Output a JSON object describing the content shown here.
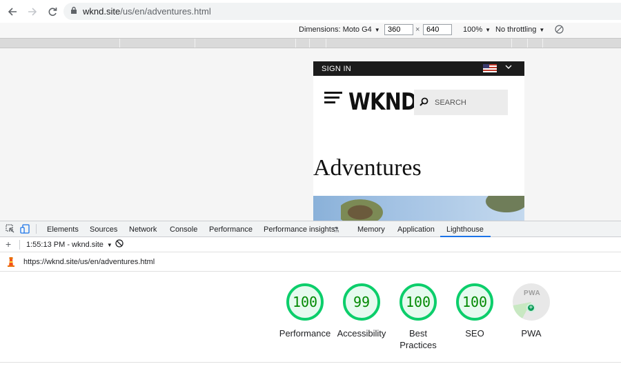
{
  "browser": {
    "url_host": "wknd.site",
    "url_path": "/us/en/adventures.html",
    "icons": [
      "back-arrow-icon",
      "forward-arrow-icon",
      "reload-icon",
      "lock-icon"
    ]
  },
  "device_toolbar": {
    "dimensions_label": "Dimensions: Moto G4",
    "width": "360",
    "height": "640",
    "times": "×",
    "zoom": "100%",
    "throttling": "No throttling"
  },
  "site": {
    "sign_in": "SIGN IN",
    "logo": "WKND",
    "search_placeholder": "SEARCH",
    "page_title": "Adventures"
  },
  "devtools": {
    "tabs": [
      "Elements",
      "Sources",
      "Network",
      "Console",
      "Performance",
      "Performance insights",
      "Memory",
      "Application",
      "Lighthouse"
    ],
    "active_tab": "Lighthouse",
    "report_label": "1:55:13 PM - wknd.site",
    "report_url": "https://wknd.site/us/en/adventures.html",
    "scores": [
      {
        "value": "100",
        "label": "Performance"
      },
      {
        "value": "99",
        "label": "Accessibility"
      },
      {
        "value": "100",
        "label": "Best Practices"
      },
      {
        "value": "100",
        "label": "SEO"
      }
    ],
    "pwa": {
      "label": "PWA",
      "badge_text": "PWA"
    },
    "colors": {
      "pass": "#0cce6b",
      "accent": "#1a73e8"
    }
  }
}
